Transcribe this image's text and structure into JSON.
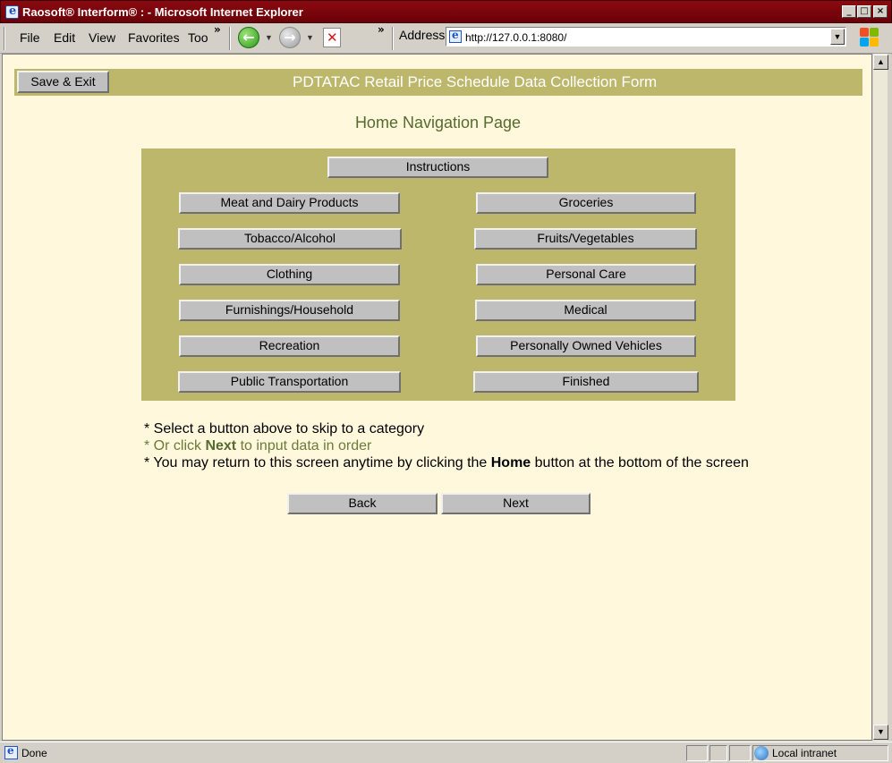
{
  "window": {
    "title": "Raosoft® Interform® : - Microsoft Internet Explorer"
  },
  "menubar": {
    "file": "File",
    "edit": "Edit",
    "view": "View",
    "favorites": "Favorites",
    "tools": "Too",
    "more": "»"
  },
  "toolbar": {
    "more": "»",
    "address_label": "Address",
    "url": "http://127.0.0.1:8080/"
  },
  "form": {
    "save_exit": "Save & Exit",
    "title": "PDTATAC Retail Price Schedule Data Collection Form",
    "subtitle": "Home Navigation Page",
    "instructions": "Instructions",
    "categories": {
      "meat_dairy": "Meat and Dairy Products",
      "groceries": "Groceries",
      "tobacco": "Tobacco/Alcohol",
      "fruits": "Fruits/Vegetables",
      "clothing": "Clothing",
      "personal_care": "Personal Care",
      "furnishings": "Furnishings/Household",
      "medical": "Medical",
      "recreation": "Recreation",
      "vehicles": "Personally Owned Vehicles",
      "transportation": "Public Transportation",
      "finished": "Finished"
    },
    "notes": {
      "line1": "* Select a button above to skip to a category",
      "line2_a": "* Or click ",
      "line2_b": "Next",
      "line2_c": " to input data in order",
      "line3_a": "* You may return to this screen anytime by clicking the ",
      "line3_b": "Home",
      "line3_c": " button at the bottom of the screen"
    },
    "back": "Back",
    "next": "Next"
  },
  "statusbar": {
    "status": "Done",
    "zone": "Local intranet"
  },
  "colors": {
    "page_bg": "#fff8dc",
    "khaki": "#bdb76b",
    "olive_text": "#556b2f"
  }
}
